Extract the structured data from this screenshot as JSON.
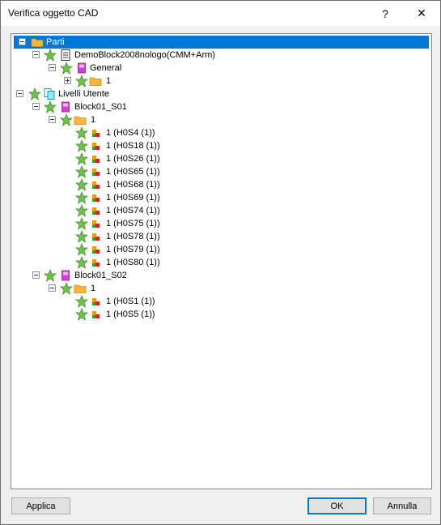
{
  "window": {
    "title": "Verifica oggetto CAD",
    "help_label": "?",
    "close_label": "✕"
  },
  "tree": {
    "nodes": [
      {
        "label": "Parti"
      },
      {
        "label": "DemoBlock2008nologo(CMM+Arm)"
      },
      {
        "label": "General"
      },
      {
        "label": "1"
      },
      {
        "label": "Livelli Utente"
      },
      {
        "label": "Block01_S01"
      },
      {
        "label": "1"
      },
      {
        "label": "1 (H0S4 (1))"
      },
      {
        "label": "1 (H0S18 (1))"
      },
      {
        "label": "1 (H0S26 (1))"
      },
      {
        "label": "1 (H0S65 (1))"
      },
      {
        "label": "1 (H0S68 (1))"
      },
      {
        "label": "1 (H0S69 (1))"
      },
      {
        "label": "1 (H0S74 (1))"
      },
      {
        "label": "1 (H0S75 (1))"
      },
      {
        "label": "1 (H0S78 (1))"
      },
      {
        "label": "1 (H0S79 (1))"
      },
      {
        "label": "1 (H0S80 (1))"
      },
      {
        "label": "Block01_S02"
      },
      {
        "label": "1"
      },
      {
        "label": "1 (H0S1 (1))"
      },
      {
        "label": "1 (H0S5 (1))"
      }
    ]
  },
  "buttons": {
    "apply": "Applica",
    "ok": "OK",
    "cancel": "Annulla"
  },
  "colors": {
    "selection": "#0078d7",
    "star": "#6cc24a",
    "folder": "#f6b73c",
    "part": "#d33fd3"
  }
}
